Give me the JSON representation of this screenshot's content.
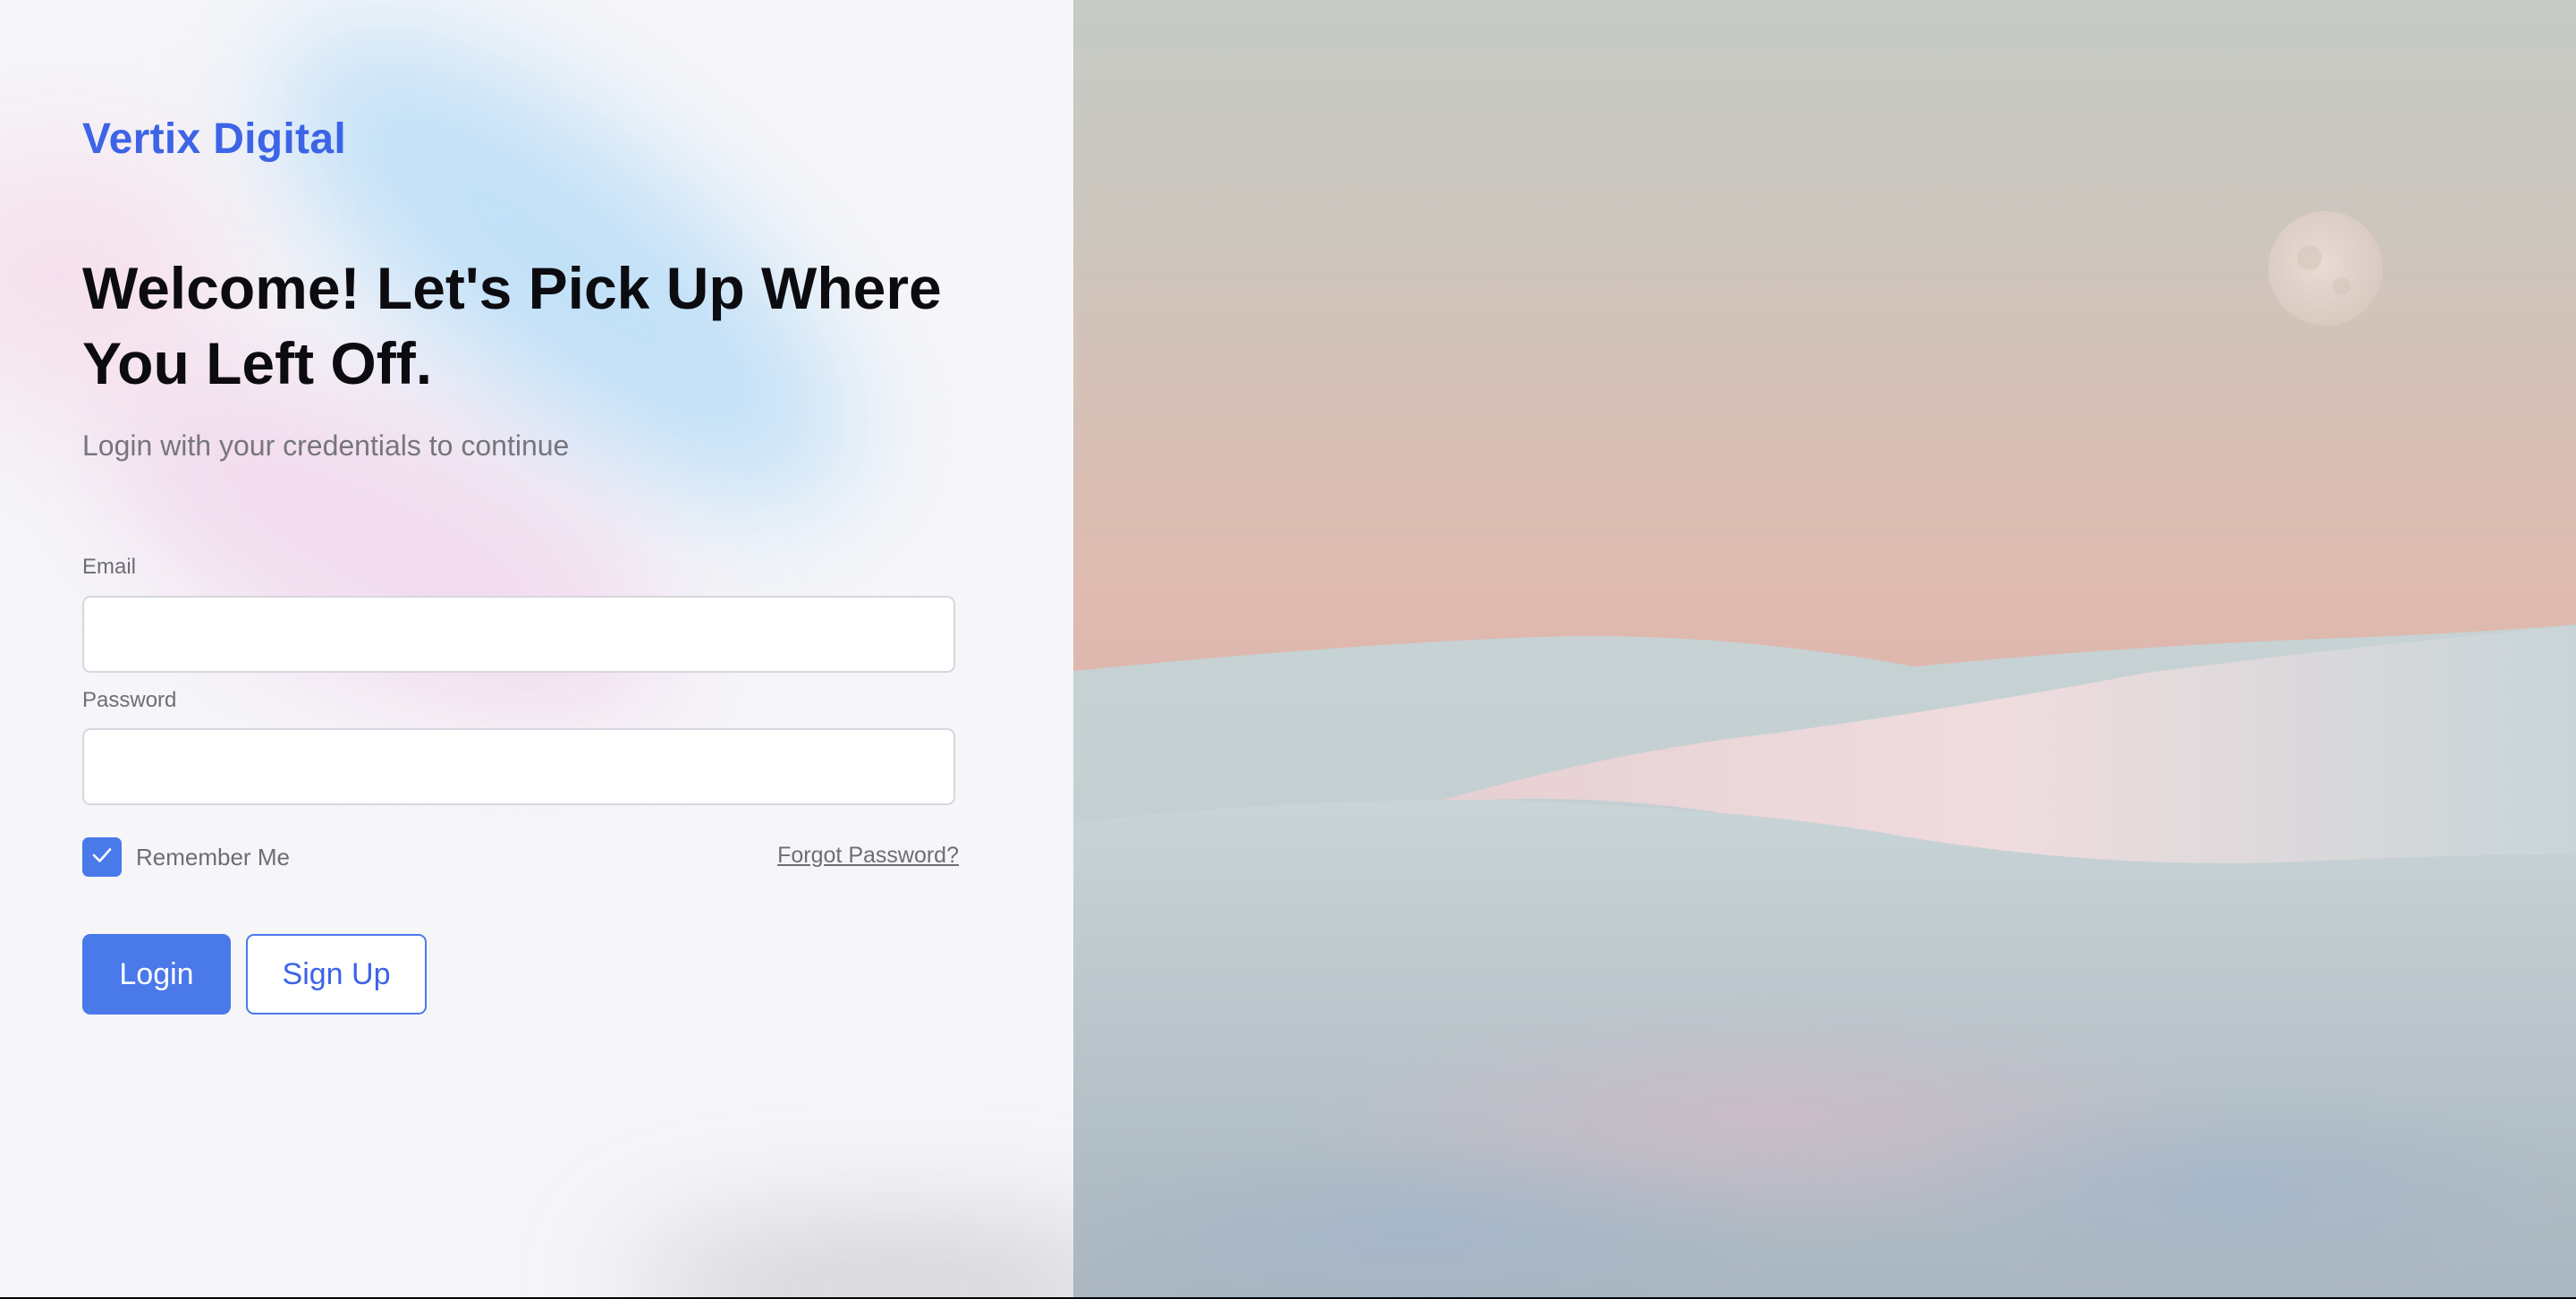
{
  "brand": {
    "name": "Vertix Digital",
    "color": "#3d64e6"
  },
  "hero": {
    "headline": "Welcome! Let's Pick Up Where You Left Off.",
    "subtitle": "Login with your credentials to continue"
  },
  "form": {
    "email": {
      "label": "Email",
      "value": "",
      "placeholder": ""
    },
    "password": {
      "label": "Password",
      "value": "",
      "placeholder": ""
    },
    "remember_me": {
      "label": "Remember Me",
      "checked": true
    },
    "forgot_password": "Forgot Password?",
    "login_button": "Login",
    "signup_button": "Sign Up"
  },
  "icons": {
    "checkbox": "checkmark-icon",
    "hero_image": "desert-dunes-moon-image"
  },
  "colors": {
    "accent": "#4a79ea",
    "left_background": "#f6f6f9",
    "heading": "#0c0c10",
    "muted_text": "#76767e"
  }
}
